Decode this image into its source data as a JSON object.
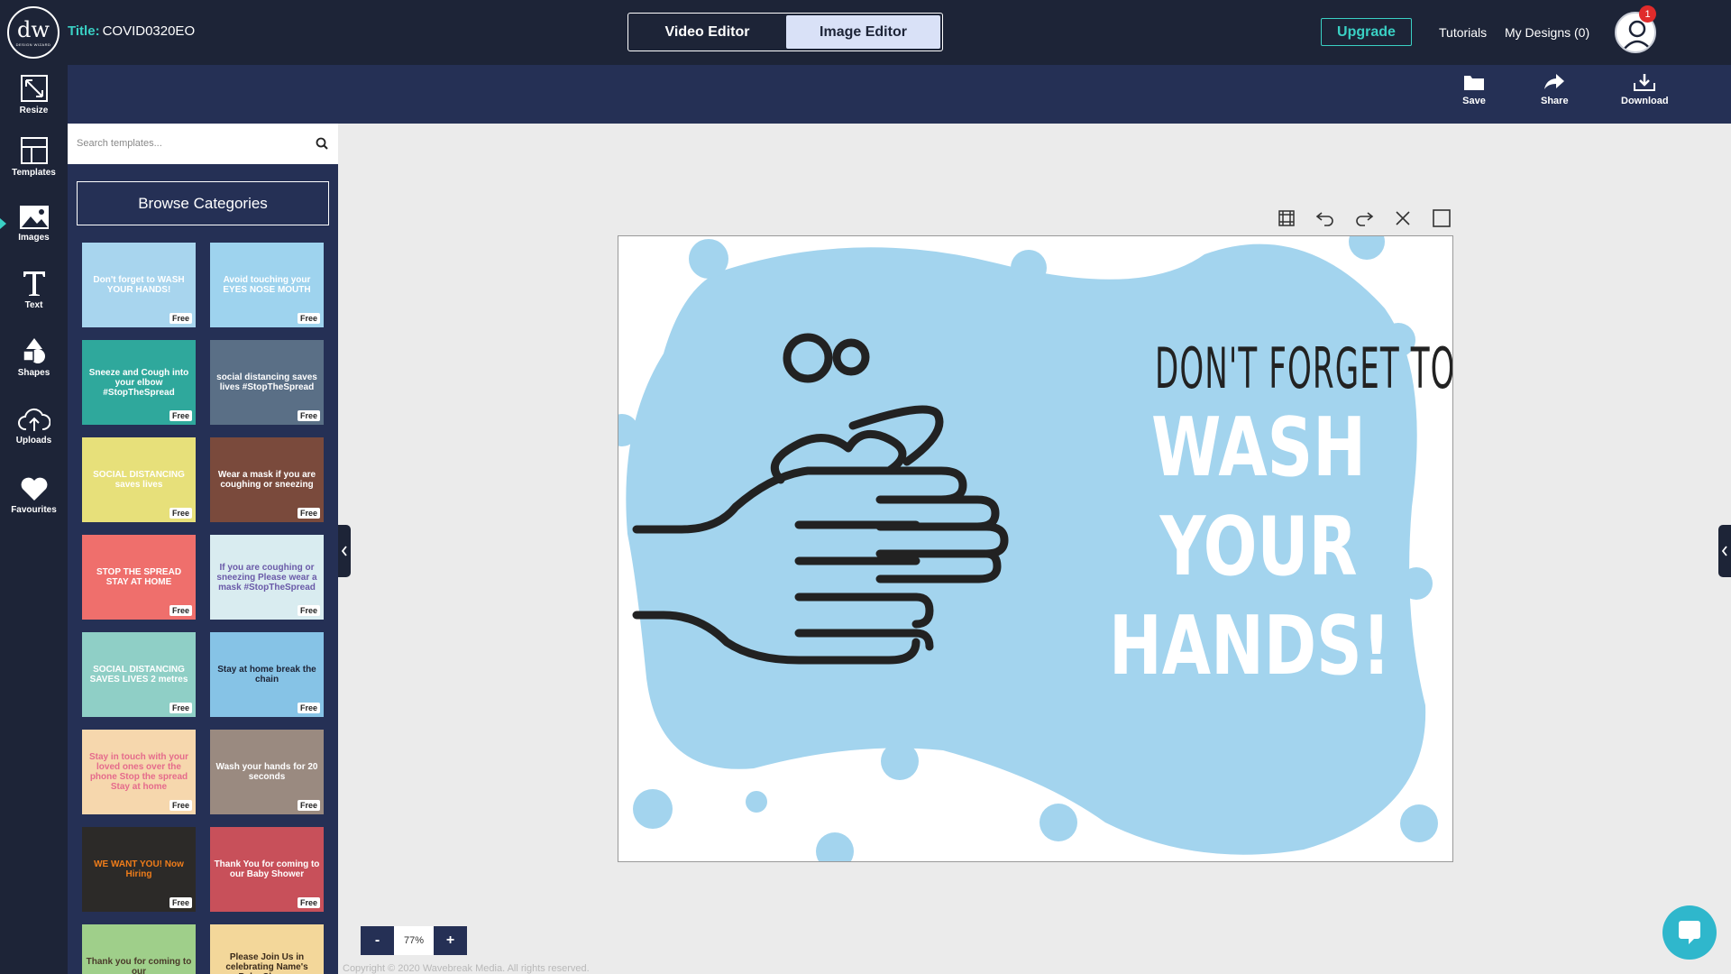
{
  "header": {
    "logo_main": "dw",
    "logo_sub": "DESIGN WIZARD",
    "title_label": "Title:",
    "title_value": "COVID0320EO",
    "editor_tabs": [
      {
        "label": "Video Editor",
        "active": false
      },
      {
        "label": "Image Editor",
        "active": true
      }
    ],
    "upgrade_label": "Upgrade",
    "tutorials_label": "Tutorials",
    "my_designs_label": "My Designs (0)",
    "notification_count": "1"
  },
  "actions": {
    "save": "Save",
    "share": "Share",
    "download": "Download"
  },
  "leftnav": [
    {
      "label": "Resize",
      "icon": "resize-icon"
    },
    {
      "label": "Templates",
      "icon": "templates-icon"
    },
    {
      "label": "Images",
      "icon": "images-icon"
    },
    {
      "label": "Text",
      "icon": "text-icon"
    },
    {
      "label": "Shapes",
      "icon": "shapes-icon"
    },
    {
      "label": "Uploads",
      "icon": "upload-icon"
    },
    {
      "label": "Favourites",
      "icon": "heart-icon"
    }
  ],
  "panel": {
    "search_placeholder": "Search templates...",
    "browse_label": "Browse Categories",
    "free_label": "Free",
    "templates": [
      {
        "text": "Don't forget to WASH YOUR HANDS!",
        "bg": "#a8d5ee",
        "fg": "#ffffff"
      },
      {
        "text": "Avoid touching your EYES NOSE MOUTH",
        "bg": "#9ed3ee",
        "fg": "#ffffff"
      },
      {
        "text": "Sneeze and Cough into your elbow #StopTheSpread",
        "bg": "#2fa89c",
        "fg": "#ffffff"
      },
      {
        "text": "social distancing saves lives #StopTheSpread",
        "bg": "#5a6f86",
        "fg": "#ffffff"
      },
      {
        "text": "SOCIAL DISTANCING saves lives",
        "bg": "#e7e07a",
        "fg": "#ffffff"
      },
      {
        "text": "Wear a mask if you are coughing or sneezing",
        "bg": "#7a4a3c",
        "fg": "#ffffff"
      },
      {
        "text": "STOP THE SPREAD STAY AT HOME",
        "bg": "#ef6f6c",
        "fg": "#ffffff"
      },
      {
        "text": "If you are coughing or sneezing Please wear a mask #StopTheSpread",
        "bg": "#d9ecf0",
        "fg": "#6a5aa8"
      },
      {
        "text": "SOCIAL DISTANCING SAVES LIVES 2 metres",
        "bg": "#8fcfc6",
        "fg": "#ffffff"
      },
      {
        "text": "Stay at home break the chain",
        "bg": "#86c3e6",
        "fg": "#1d2437"
      },
      {
        "text": "Stay in touch with your loved ones over the phone Stop the spread Stay at home",
        "bg": "#f6d7ad",
        "fg": "#e56b8c"
      },
      {
        "text": "Wash your hands for 20 seconds",
        "bg": "#9a8a80",
        "fg": "#ffffff"
      },
      {
        "text": "WE WANT YOU! Now Hiring",
        "bg": "#2c2a28",
        "fg": "#f07d1a"
      },
      {
        "text": "Thank You for coming to our Baby Shower",
        "bg": "#c8505a",
        "fg": "#ffffff"
      },
      {
        "text": "Thank you for coming to our",
        "bg": "#9fcf8a",
        "fg": "#4a3a2a"
      },
      {
        "text": "Please Join Us in celebrating Name's Baby Shower",
        "bg": "#f3d79a",
        "fg": "#3a2a1a"
      }
    ]
  },
  "canvas": {
    "line1": "DON'T FORGET TO",
    "line2": "WASH",
    "line3": "YOUR",
    "line4": "HANDS!",
    "blob_color": "#a3d4ee",
    "outline_color": "#222222"
  },
  "zoom": {
    "minus": "-",
    "value": "77%",
    "plus": "+"
  },
  "copyright": "Copyright © 2020 Wavebreak Media. All rights reserved."
}
